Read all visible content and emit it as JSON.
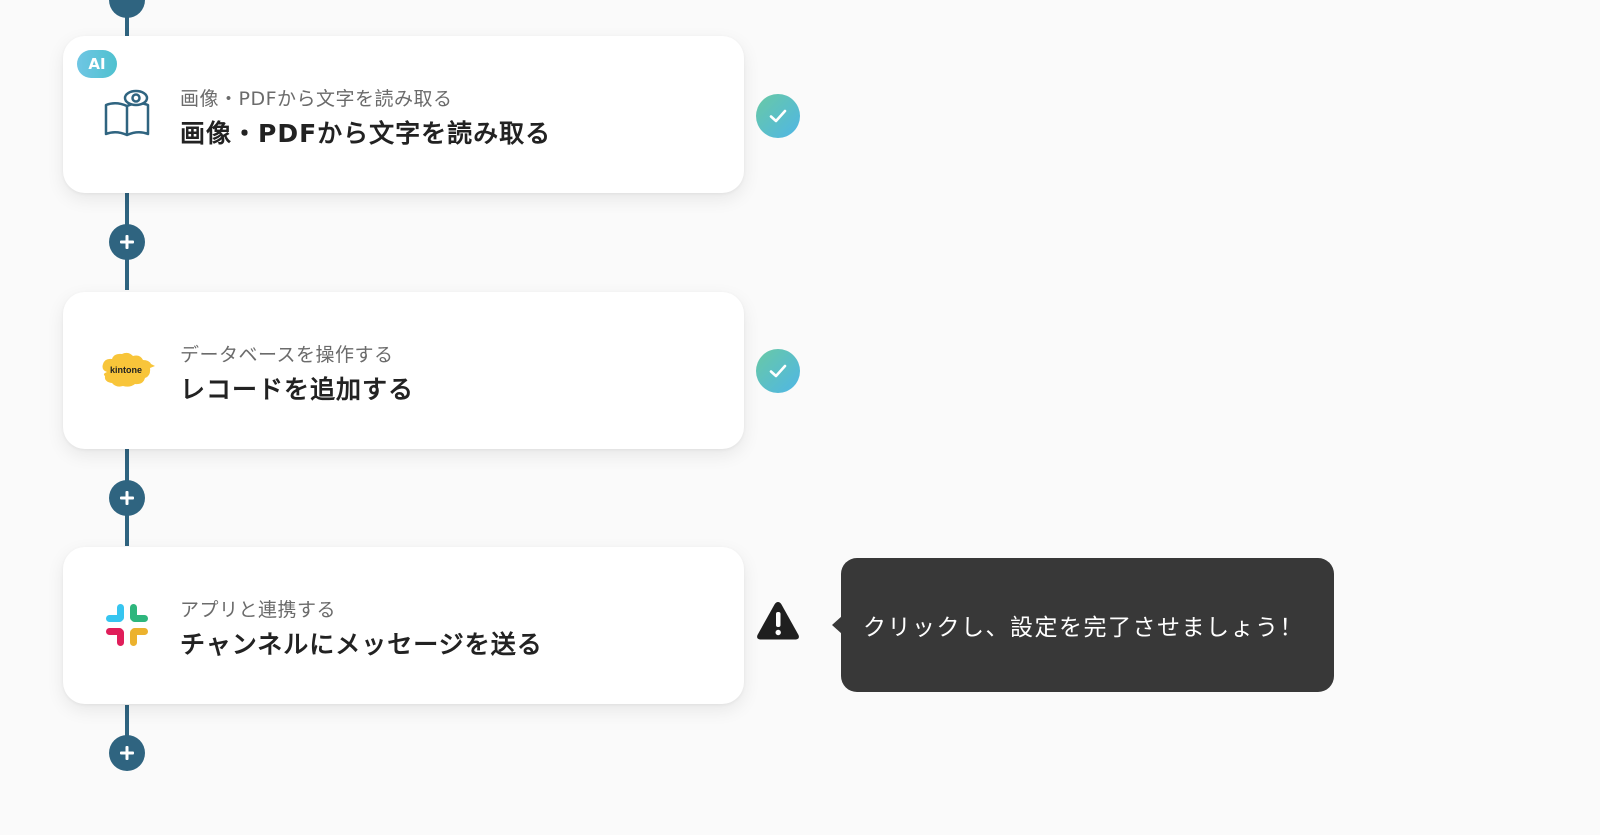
{
  "flow": {
    "steps": [
      {
        "badge": "AI",
        "icon": "book-eye-icon",
        "subtitle": "画像・PDFから文字を読み取る",
        "title": "画像・PDFから文字を読み取る",
        "status": "completed"
      },
      {
        "icon": "kintone-logo-icon",
        "icon_text": "kintone",
        "subtitle": "データベースを操作する",
        "title": "レコードを追加する",
        "status": "completed"
      },
      {
        "icon": "slack-logo-icon",
        "subtitle": "アプリと連携する",
        "title": "チャンネルにメッセージを送る",
        "status": "warning"
      }
    ]
  },
  "tooltip": {
    "text": "クリックし、設定を完了させましょう！"
  },
  "colors": {
    "background": "#fafafa",
    "flow_line": "#2f6480",
    "check_gradient_start": "#69c9a4",
    "check_gradient_end": "#4fb6e6",
    "ai_badge": "#5ec3dc",
    "tooltip_bg": "#383838",
    "warning": "#1f1f1f",
    "kintone_yellow": "#f8c53a",
    "slack_blue": "#36c5f0",
    "slack_green": "#2eb67d",
    "slack_yellow": "#ecb22e",
    "slack_red": "#e01e5a"
  }
}
